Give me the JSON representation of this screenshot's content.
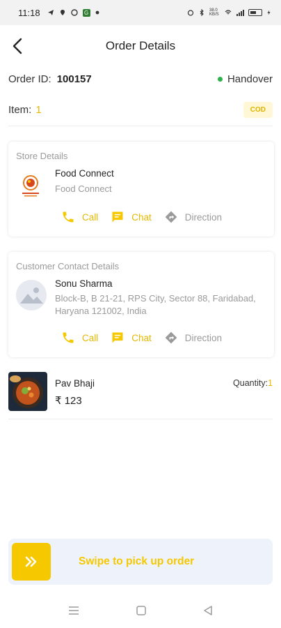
{
  "status_bar": {
    "time": "11:18",
    "signal_text": "38.0 KB/S",
    "battery_level": 0.35
  },
  "header": {
    "title": "Order Details",
    "back_icon": "chevron-left-icon"
  },
  "order": {
    "id_label": "Order ID:",
    "id_value": "100157",
    "status": "Handover",
    "status_color": "#2bb34b",
    "item_label": "Item:",
    "item_count": "1",
    "payment_badge": "COD"
  },
  "store_card": {
    "title": "Store Details",
    "name": "Food Connect",
    "subtitle": "Food Connect",
    "actions": [
      {
        "label": "Call",
        "icon": "phone-icon"
      },
      {
        "label": "Chat",
        "icon": "chat-icon"
      },
      {
        "label": "Direction",
        "icon": "direction-icon"
      }
    ]
  },
  "customer_card": {
    "title": "Customer Contact Details",
    "name": "Sonu Sharma",
    "address": "Block-B, B 21-21, RPS City, Sector 88, Faridabad, Haryana 121002, India",
    "actions": [
      {
        "label": "Call",
        "icon": "phone-icon"
      },
      {
        "label": "Chat",
        "icon": "chat-icon"
      },
      {
        "label": "Direction",
        "icon": "direction-icon"
      }
    ]
  },
  "product": {
    "name": "Pav Bhaji",
    "price": "₹ 123",
    "quantity_label": "Quantity:",
    "quantity_value": "1"
  },
  "swipe": {
    "label": "Swipe to pick up order",
    "handle_icon": "double-chevron-right-icon"
  },
  "colors": {
    "accent": "#f5c800",
    "status_green": "#2bb34b",
    "muted": "#9a9a9a"
  }
}
